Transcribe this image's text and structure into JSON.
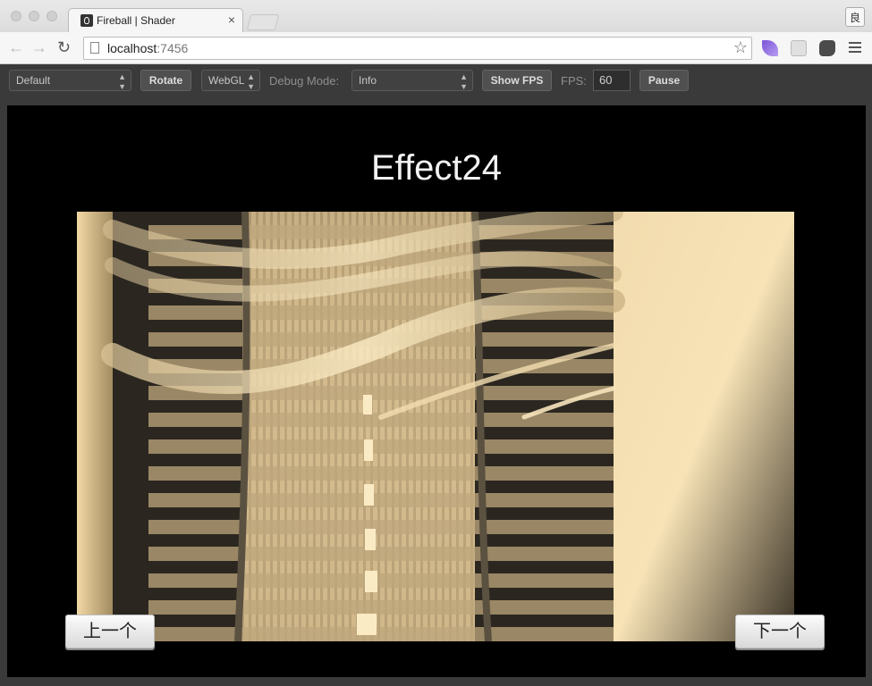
{
  "browser": {
    "tab_title": "Fireball | Shader",
    "tab_close": "×",
    "url_host": "localhost",
    "url_port": ":7456",
    "profile_glyph": "良"
  },
  "controls": {
    "preset_select": "Default",
    "rotate_button": "Rotate",
    "renderer_select": "WebGL",
    "debug_mode_label": "Debug Mode:",
    "debug_mode_select": "Info",
    "show_fps_button": "Show FPS",
    "fps_label": "FPS:",
    "fps_value": "60",
    "pause_button": "Pause"
  },
  "canvas": {
    "effect_title": "Effect24",
    "prev_button": "上一个",
    "next_button": "下一个"
  }
}
